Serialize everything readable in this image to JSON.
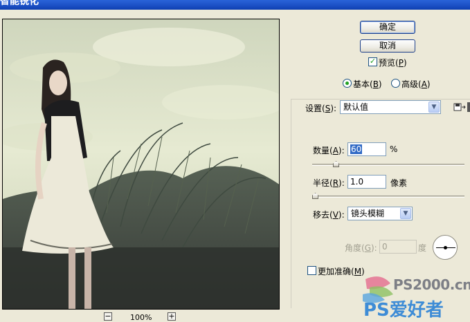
{
  "window": {
    "title": "智能锐化"
  },
  "preview": {
    "zoom": "100%",
    "zoom_out": "−",
    "zoom_in": "+"
  },
  "buttons": {
    "ok": "确定",
    "cancel": "取消"
  },
  "preview_toggle": {
    "label": "预览(",
    "key": "P",
    "suffix": ")",
    "checked": true
  },
  "mode": {
    "basic": {
      "label": "基本(",
      "key": "B",
      "suffix": ")",
      "selected": true
    },
    "advanced": {
      "label": "高级(",
      "key": "A",
      "suffix": ")",
      "selected": false
    }
  },
  "settings": {
    "label": "设置(",
    "key": "S",
    "suffix": "):",
    "value": "默认值"
  },
  "amount": {
    "label": "数量(",
    "key": "A",
    "suffix": "):",
    "value": "60",
    "unit": "%",
    "slider_fraction": 0.14
  },
  "radius": {
    "label": "半径(",
    "key": "R",
    "suffix": "):",
    "value": "1.0",
    "unit": "像素",
    "slider_fraction": 0.0
  },
  "remove": {
    "label": "移去(",
    "key": "V",
    "suffix": "):",
    "value": "镜头模糊"
  },
  "angle": {
    "label": "角度(",
    "key": "G",
    "suffix": "):",
    "value": "0",
    "unit": "度"
  },
  "more_accurate": {
    "label": "更加准确(",
    "key": "M",
    "suffix": ")",
    "checked": false
  },
  "watermark": {
    "line1": "PS2000.cn",
    "line2": "PS爱好者"
  },
  "icons": {
    "save": "save-settings-icon",
    "delete": "delete-settings-icon",
    "check": "✓",
    "dropdown": "▼"
  },
  "colors": {
    "accent": "#316ac5",
    "check": "#21a121",
    "titlebar": "#1b4fc4"
  }
}
